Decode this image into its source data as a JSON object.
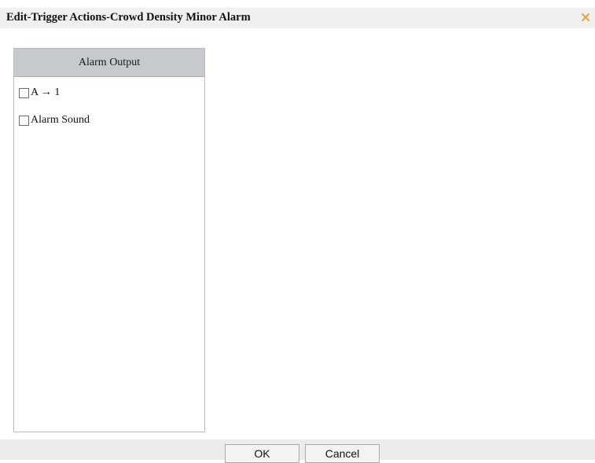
{
  "dialog": {
    "title": "Edit-Trigger Actions-Crowd Density Minor Alarm",
    "close_icon": "close-icon",
    "accent_color": "#e8a33c"
  },
  "alarm_output": {
    "header": "Alarm Output",
    "options": [
      {
        "label": "A → 1",
        "checked": false
      },
      {
        "label": "Alarm Sound",
        "checked": false
      }
    ]
  },
  "footer": {
    "ok_label": "OK",
    "cancel_label": "Cancel"
  }
}
